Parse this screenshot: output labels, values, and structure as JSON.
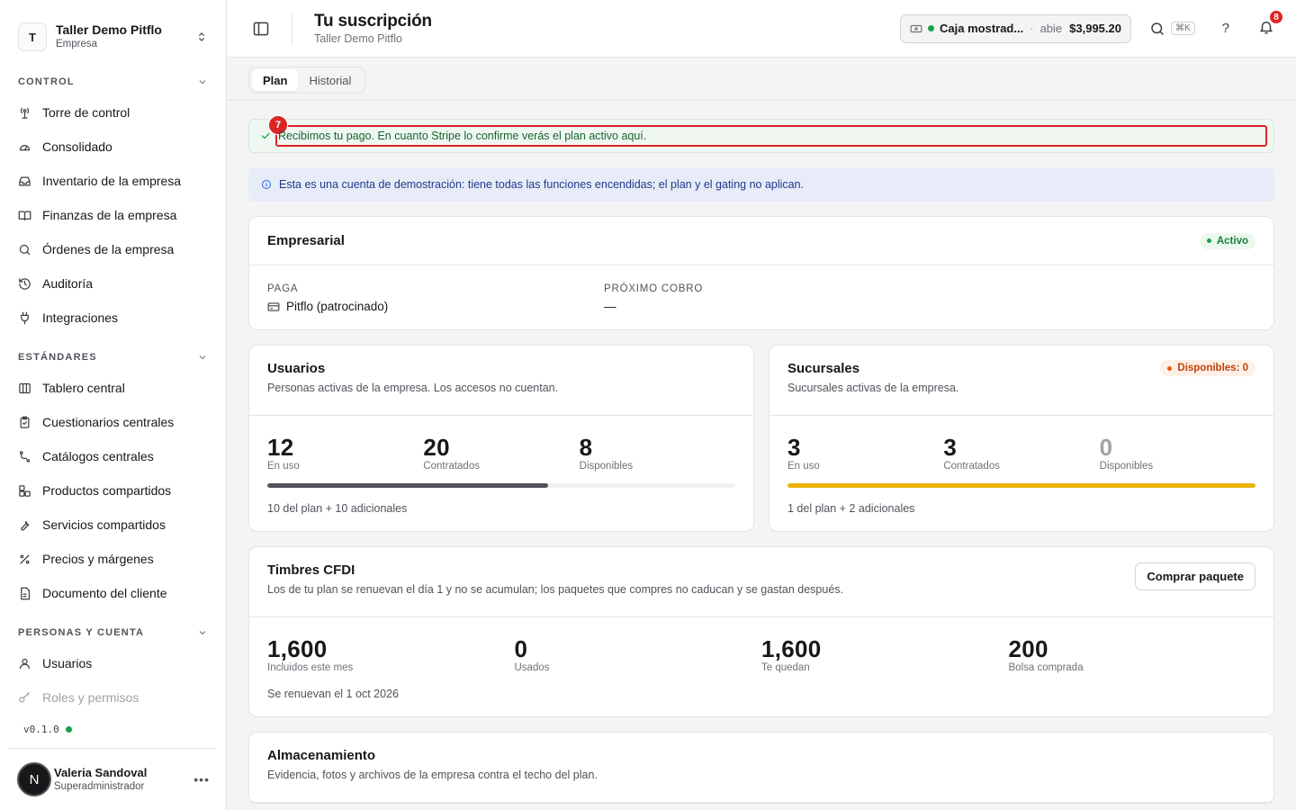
{
  "org": {
    "initial": "T",
    "name": "Taller Demo Pitflo",
    "type": "Empresa"
  },
  "sections": [
    {
      "title": "CONTROL",
      "items": [
        "Torre de control",
        "Consolidado",
        "Inventario de la empresa",
        "Finanzas de la empresa",
        "Órdenes de la empresa",
        "Auditoría",
        "Integraciones"
      ]
    },
    {
      "title": "ESTÁNDARES",
      "items": [
        "Tablero central",
        "Cuestionarios centrales",
        "Catálogos centrales",
        "Productos compartidos",
        "Servicios compartidos",
        "Precios y márgenes",
        "Documento del cliente"
      ]
    },
    {
      "title": "PERSONAS Y CUENTA",
      "items": [
        "Usuarios",
        "Roles y permisos"
      ]
    }
  ],
  "version": "v0.1.0",
  "user": {
    "initial": "N",
    "name": "Valeria Sandoval",
    "role": "Superadministrador"
  },
  "header": {
    "title": "Tu suscripción",
    "subtitle": "Taller Demo Pitflo"
  },
  "cash": {
    "name": "Caja mostrad...",
    "sep": "·",
    "state": "abie",
    "amount": "$3,995.20"
  },
  "search_kbd": "⌘K",
  "help": "?",
  "notifications": "8",
  "tabs": [
    "Plan",
    "Historial"
  ],
  "highlight_number": "7",
  "success_message": "Recibimos tu pago. En cuanto Stripe lo confirme verás el plan activo aquí.",
  "info_message": "Esta es una cuenta de demostración: tiene todas las funciones encendidas; el plan y el gating no aplican.",
  "plan": {
    "name": "Empresarial",
    "status": "Activo",
    "paga_label": "PAGA",
    "paga_value": "Pitflo (patrocinado)",
    "next_label": "PRÓXIMO COBRO",
    "next_value": "—"
  },
  "usuarios": {
    "title": "Usuarios",
    "desc": "Personas activas de la empresa. Los accesos no cuentan.",
    "stats": [
      {
        "num": "12",
        "label": "En uso"
      },
      {
        "num": "20",
        "label": "Contratados"
      },
      {
        "num": "8",
        "label": "Disponibles"
      }
    ],
    "usage": 0.6,
    "note": "10 del plan + 10 adicionales"
  },
  "sucursales": {
    "title": "Sucursales",
    "desc": "Sucursales activas de la empresa.",
    "badge": "Disponibles: 0",
    "stats": [
      {
        "num": "3",
        "label": "En uso"
      },
      {
        "num": "3",
        "label": "Contratados"
      },
      {
        "num": "0",
        "label": "Disponibles"
      }
    ],
    "usage": 1.0,
    "note": "1 del plan + 2 adicionales"
  },
  "timbres": {
    "title": "Timbres CFDI",
    "desc": "Los de tu plan se renuevan el día 1 y no se acumulan; los paquetes que compres no caducan y se gastan después.",
    "button": "Comprar paquete",
    "stats": [
      {
        "num": "1,600",
        "label": "Incluidos este mes"
      },
      {
        "num": "0",
        "label": "Usados"
      },
      {
        "num": "1,600",
        "label": "Te quedan"
      },
      {
        "num": "200",
        "label": "Bolsa comprada"
      }
    ],
    "note": "Se renuevan el 1 oct 2026"
  },
  "almacenamiento": {
    "title": "Almacenamiento",
    "desc": "Evidencia, fotos y archivos de la empresa contra el techo del plan."
  },
  "colors": {
    "bar_users": "#52525b",
    "bar_branches": "#eab308",
    "accent_red": "#dc2626"
  }
}
